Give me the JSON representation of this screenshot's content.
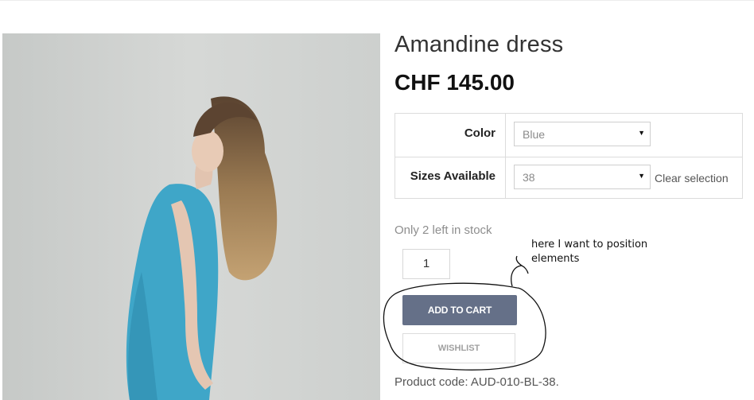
{
  "product": {
    "title": "Amandine dress",
    "price": "CHF 145.00",
    "image_alt_icon": "product-photo"
  },
  "variations": {
    "color": {
      "label": "Color",
      "selected": "Blue"
    },
    "size": {
      "label": "Sizes Available",
      "selected": "38"
    },
    "clear_label": "Clear selection"
  },
  "stock": {
    "text": "Only 2 left in stock"
  },
  "quantity": {
    "value": "1"
  },
  "actions": {
    "add_to_cart": "ADD TO CART",
    "wishlist": "WISHLIST"
  },
  "meta": {
    "product_code": "Product code: AUD-010-BL-38."
  },
  "annotation": {
    "note": "here I want to position elements"
  },
  "colors": {
    "cart_button": "#657088",
    "dress": "#3fa6c8"
  }
}
